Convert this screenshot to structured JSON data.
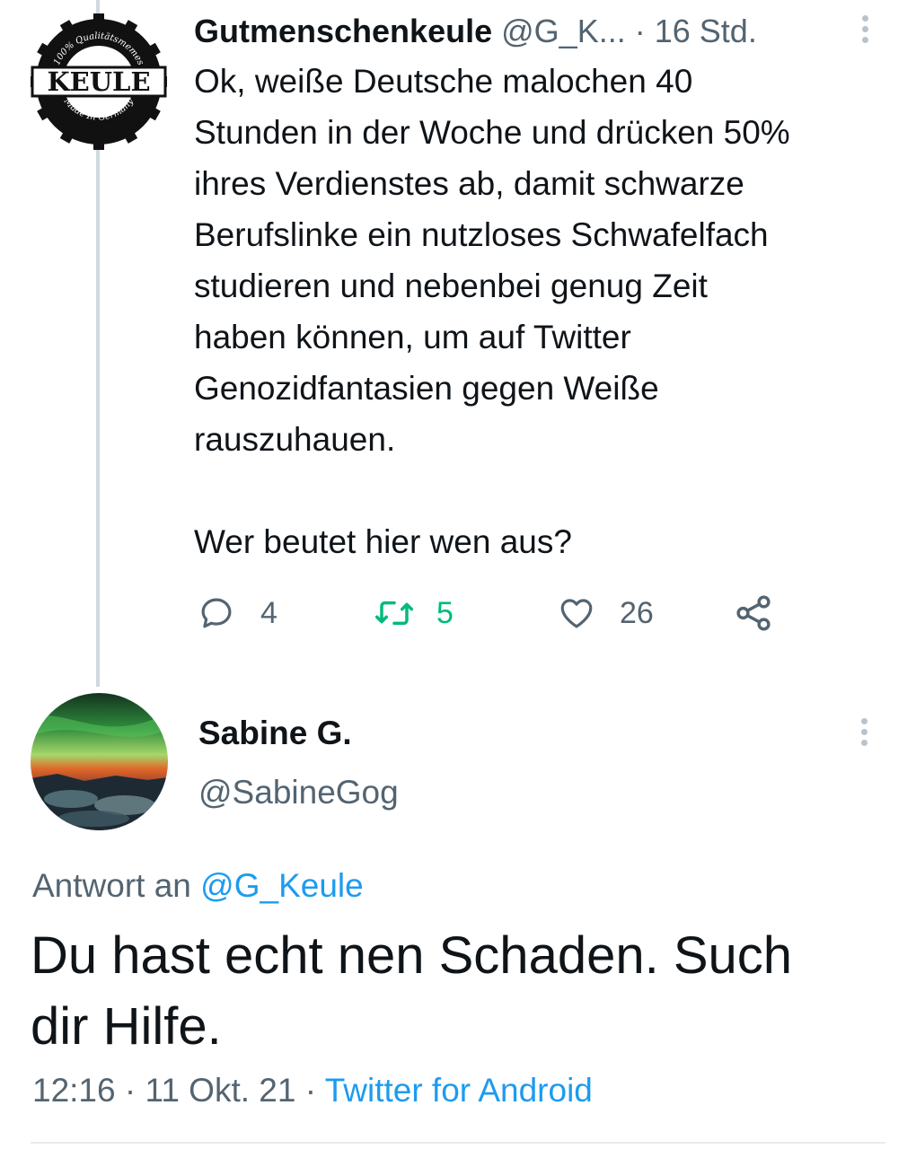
{
  "tweet": {
    "avatar": {
      "logo_word": "KEULE",
      "logo_ring_top": "100% Qualitätsmemes",
      "logo_ring_bottom": "Made In Germany"
    },
    "display_name": "Gutmenschenkeule",
    "handle": "@G_K...",
    "separator": "·",
    "time": "16 Std.",
    "text": "Ok, weiße Deutsche malochen 40\nStunden in der Woche und drücken 50%\nihres Verdienstes ab, damit schwarze\nBerufslinke ein nutzloses Schwafelfach\nstudieren und nebenbei genug Zeit\nhaben können, um auf Twitter\nGenozidfantasien gegen Weiße\nrauszuhauen.\n\nWer beutet hier wen aus?",
    "actions": {
      "replies": "4",
      "retweets": "5",
      "likes": "26"
    }
  },
  "reply": {
    "display_name": "Sabine G.",
    "handle": "@SabineGog",
    "reply_prefix": "Antwort an ",
    "reply_to": "@G_Keule",
    "text": "Du hast echt nen Schaden. Such\ndir Hilfe.",
    "time": "12:16",
    "date": "11 Okt. 21",
    "separator": "·",
    "source": "Twitter for Android"
  },
  "colors": {
    "text": "#0f1419",
    "secondary": "#536471",
    "link": "#1d9bf0",
    "retweet_green": "#00ba7c",
    "thread_line": "#cfd9de"
  },
  "icons": {
    "reply": "reply-bubble-icon",
    "retweet": "retweet-icon",
    "like": "heart-icon",
    "share": "share-icon",
    "more": "more-vertical-icon"
  }
}
